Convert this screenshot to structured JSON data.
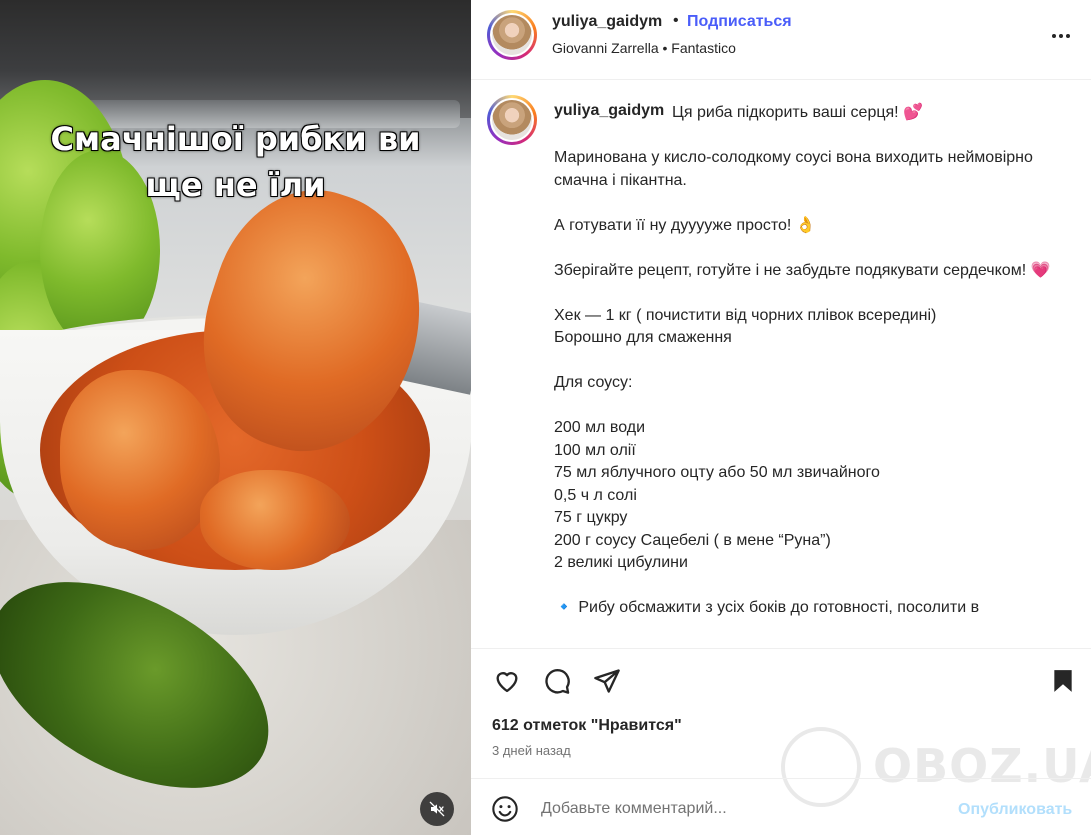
{
  "media": {
    "overlay_line1": "Смачнішої рибки ви",
    "overlay_line2": "ще не їли"
  },
  "header": {
    "username": "yuliya_gaidym",
    "separator": "•",
    "follow_label": "Подписаться",
    "audio": "Giovanni Zarrella • Fantastico"
  },
  "caption": {
    "username": "yuliya_gaidym",
    "lines": [
      "Ця риба підкорить ваші серця! 💕",
      "",
      "Маринована у кисло-солодкому соусі вона виходить неймовірно смачна і пікантна.",
      "",
      "А готувати її ну дууууже просто! 👌",
      "",
      "Зберігайте рецепт, готуйте і не забудьте подякувати сердечком! 💗",
      "",
      "Хек — 1 кг ( почистити від чорних плівок всередині)",
      "Борошно для смаження",
      "",
      "Для соусу:",
      "",
      "200 мл води",
      "100 мл олії",
      "75 мл яблучного оцту або 50 мл звичайного",
      "0,5 ч л солі",
      "75 г цукру",
      "200 г соусу Сацебелі ( в мене “Руна”)",
      "2 великі цибулини",
      "",
      "🔹 Рибу обсмажити з усіх боків до готовності, посолити в"
    ]
  },
  "actions": {
    "likes": "612 отметок \"Нравится\"",
    "time": "3 дней назад"
  },
  "comment": {
    "placeholder": "Добавьте комментарий...",
    "post_label": "Опубликовать"
  },
  "watermark": {
    "text": "OBOZ.UA"
  },
  "colors": {
    "link": "#4a5df9",
    "post_disabled": "#b2dffc",
    "text": "#262626",
    "muted": "#737373"
  }
}
